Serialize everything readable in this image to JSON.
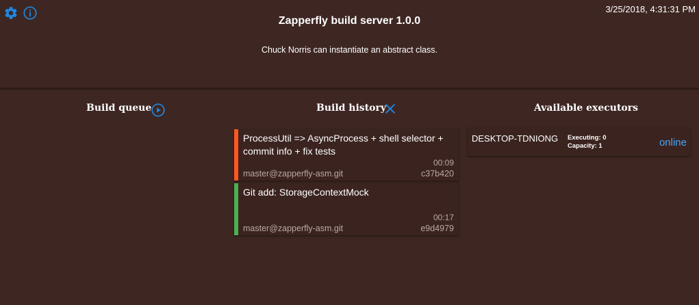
{
  "header": {
    "title": "Zapperfly build server 1.0.0",
    "joke": "Chuck Norris can instantiate an abstract class.",
    "datetime": "3/25/2018, 4:31:31 PM"
  },
  "icons": {
    "settings": "gear-icon",
    "info": "info-icon",
    "play": "play-circle-icon",
    "clear": "close-icon"
  },
  "colors": {
    "background": "#3e2723",
    "accent": "#1e88e5",
    "status_failed": "#ff5722",
    "status_success": "#4caf50",
    "online": "#42a5f5"
  },
  "build_queue": {
    "title": "Build queue",
    "items": []
  },
  "build_history": {
    "title": "Build history",
    "items": [
      {
        "message": "ProcessUtil => AsyncProcess + shell selector + commit info + fix tests",
        "duration": "00:09",
        "repo": "master@zapperfly-asm.git",
        "hash": "c37b420",
        "status": "failed"
      },
      {
        "message": "Git add: StorageContextMock",
        "duration": "00:17",
        "repo": "master@zapperfly-asm.git",
        "hash": "e9d4979",
        "status": "success"
      }
    ]
  },
  "executors": {
    "title": "Available executors",
    "items": [
      {
        "name": "DESKTOP-TDNIONG",
        "executing": "Executing: 0",
        "capacity": "Capacity: 1",
        "status": "online"
      }
    ]
  }
}
